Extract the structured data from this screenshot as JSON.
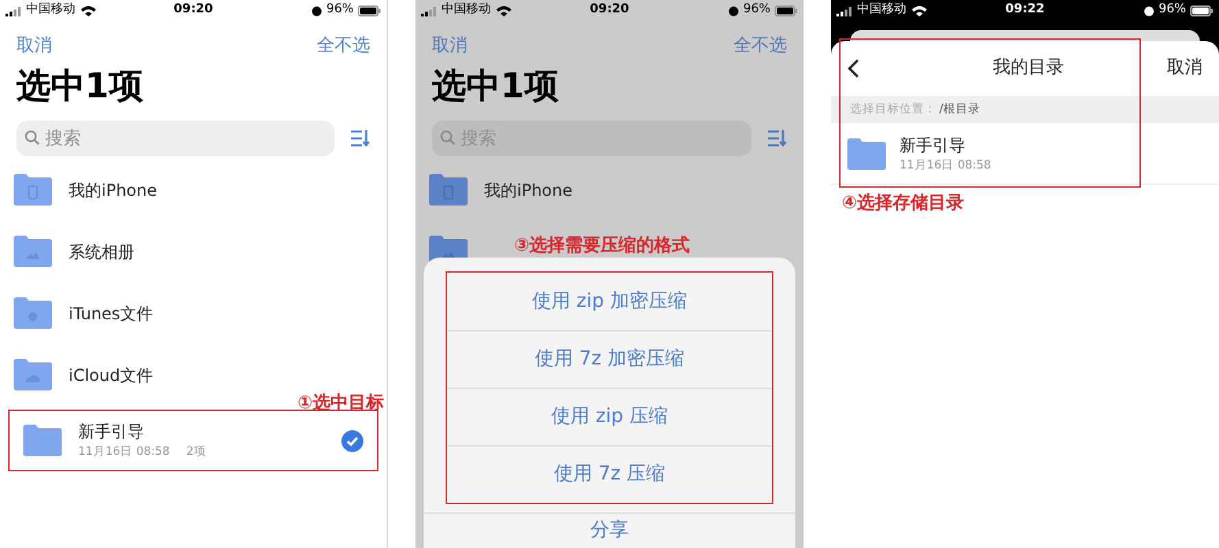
{
  "panels": [
    {
      "kind": "files",
      "status": {
        "carrier": "中国移动",
        "time": "09:20",
        "battery": "96%"
      },
      "nav": {
        "left": "取消",
        "right": "全不选"
      },
      "title": "选中1项",
      "search": {
        "placeholder": "搜索"
      },
      "items": [
        {
          "name": "我的iPhone",
          "kind": "phone",
          "selected": false
        },
        {
          "name": "系统相册",
          "kind": "photo",
          "selected": false
        },
        {
          "name": "iTunes文件",
          "kind": "apple",
          "selected": false
        },
        {
          "name": "iCloud文件",
          "kind": "cloud",
          "selected": false
        },
        {
          "name": "新手引导",
          "kind": "plain",
          "date": "11月16日 08:58",
          "count": "2项",
          "selected": true
        }
      ],
      "annotation": "①选中目标"
    },
    {
      "kind": "sheet",
      "status": {
        "carrier": "中国移动",
        "time": "09:20",
        "battery": "96%"
      },
      "nav": {
        "left": "取消",
        "right": "全不选"
      },
      "title": "选中1项",
      "search": {
        "placeholder": "搜索"
      },
      "items": [
        {
          "name": "我的iPhone",
          "kind": "phone"
        },
        {
          "kind": "photo"
        }
      ],
      "annotation": "③选择需要压缩的格式",
      "options": [
        "使用 zip 加密压缩",
        "使用 7z 加密压缩",
        "使用 zip 压缩",
        "使用 7z 压缩"
      ],
      "share": "分享"
    },
    {
      "kind": "picker",
      "status": {
        "carrier": "中国移动",
        "time": "09:22",
        "battery": "96%"
      },
      "header": {
        "title": "我的目录",
        "cancel": "取消"
      },
      "path_label": "选择目标位置：",
      "path": "/根目录",
      "folders": [
        {
          "name": "新手引导",
          "date": "11月16日 08:58"
        }
      ],
      "annotation": "④选择存储目录"
    }
  ]
}
